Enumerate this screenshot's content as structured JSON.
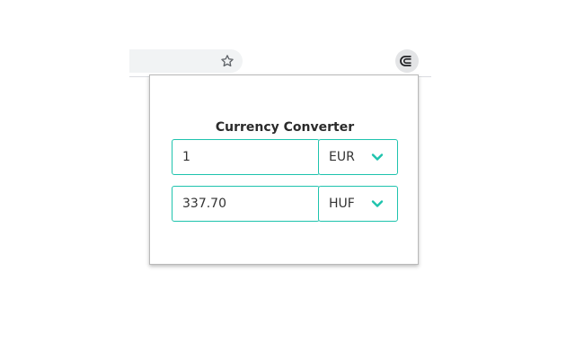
{
  "browser": {
    "bookmark_icon": "star-outline-icon",
    "extension_icon": "currency-converter-extension-icon"
  },
  "popup": {
    "title": "Currency Converter",
    "rows": [
      {
        "amount": "1",
        "currency": "EUR"
      },
      {
        "amount": "337.70",
        "currency": "HUF"
      }
    ]
  },
  "colors": {
    "accent": "#1ec3ad",
    "title_text": "#2b2b2b",
    "body_text": "#333333",
    "toolbar_bg": "#f1f3f4"
  }
}
